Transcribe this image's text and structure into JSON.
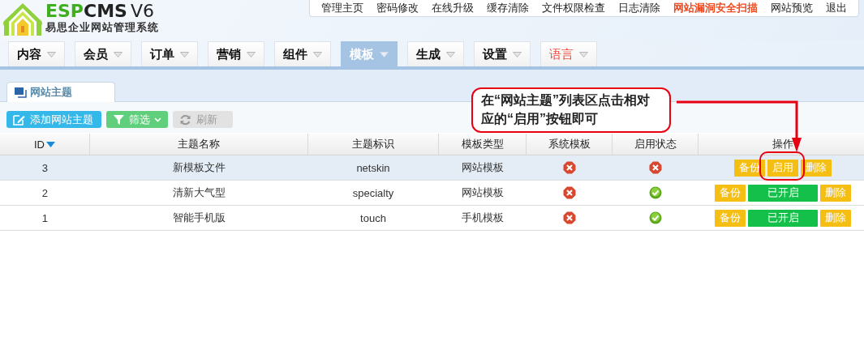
{
  "logo": {
    "title_green": "ESP",
    "title_dark": "CMS",
    "version": "V6",
    "subtitle": "易思企业网站管理系统"
  },
  "top_links": [
    {
      "label": "管理主页",
      "kind": "normal"
    },
    {
      "label": "密码修改",
      "kind": "normal"
    },
    {
      "label": "在线升级",
      "kind": "normal"
    },
    {
      "label": "缓存清除",
      "kind": "normal"
    },
    {
      "label": "文件权限检查",
      "kind": "normal"
    },
    {
      "label": "日志清除",
      "kind": "normal"
    },
    {
      "label": "网站漏洞安全扫描",
      "kind": "alert"
    },
    {
      "label": "网站预览",
      "kind": "normal"
    },
    {
      "label": "退出",
      "kind": "normal"
    }
  ],
  "nav_tabs": [
    {
      "label": "内容",
      "selected": false,
      "kind": "normal"
    },
    {
      "label": "会员",
      "selected": false,
      "kind": "normal"
    },
    {
      "label": "订单",
      "selected": false,
      "kind": "normal"
    },
    {
      "label": "营销",
      "selected": false,
      "kind": "normal"
    },
    {
      "label": "组件",
      "selected": false,
      "kind": "normal"
    },
    {
      "label": "模板",
      "selected": true,
      "kind": "normal"
    },
    {
      "label": "生成",
      "selected": false,
      "kind": "normal"
    },
    {
      "label": "设置",
      "selected": false,
      "kind": "normal"
    },
    {
      "label": "语言",
      "selected": false,
      "kind": "alert"
    }
  ],
  "page_tabs": [
    {
      "label": "网站主题",
      "selected": true
    }
  ],
  "toolbar": [
    {
      "label": "添加网站主题",
      "kind": "add"
    },
    {
      "label": "筛选",
      "kind": "filter"
    },
    {
      "label": "刷新",
      "kind": "refresh"
    }
  ],
  "table": {
    "columns": [
      {
        "label": "ID",
        "sorted": true
      },
      {
        "label": "主题名称",
        "sorted": false
      },
      {
        "label": "主题标识",
        "sorted": false
      },
      {
        "label": "模板类型",
        "sorted": false
      },
      {
        "label": "系统模板",
        "sorted": false
      },
      {
        "label": "启用状态",
        "sorted": false
      },
      {
        "label": "操作",
        "sorted": false
      }
    ],
    "rows": [
      {
        "id": "3",
        "name": "新模板文件",
        "key": "netskin",
        "type": "网站模板",
        "system": false,
        "enabled": false,
        "selected": true,
        "actions": [
          {
            "label": "备份",
            "kind": "backup"
          },
          {
            "label": "启用",
            "kind": "enable"
          },
          {
            "label": "删除",
            "kind": "delete"
          }
        ]
      },
      {
        "id": "2",
        "name": "清新大气型",
        "key": "specialty",
        "type": "网站模板",
        "system": false,
        "enabled": true,
        "selected": false,
        "actions": [
          {
            "label": "备份",
            "kind": "backup"
          },
          {
            "label": "已开启",
            "kind": "enabled"
          },
          {
            "label": "删除",
            "kind": "delete"
          }
        ]
      },
      {
        "id": "1",
        "name": "智能手机版",
        "key": "touch",
        "type": "手机模板",
        "system": false,
        "enabled": true,
        "selected": false,
        "actions": [
          {
            "label": "备份",
            "kind": "backup"
          },
          {
            "label": "已开启",
            "kind": "enabled"
          },
          {
            "label": "删除",
            "kind": "delete"
          }
        ]
      }
    ]
  },
  "callout": {
    "text": "在“网站主题”列表区点击相对应的“启用”按钮即可"
  }
}
